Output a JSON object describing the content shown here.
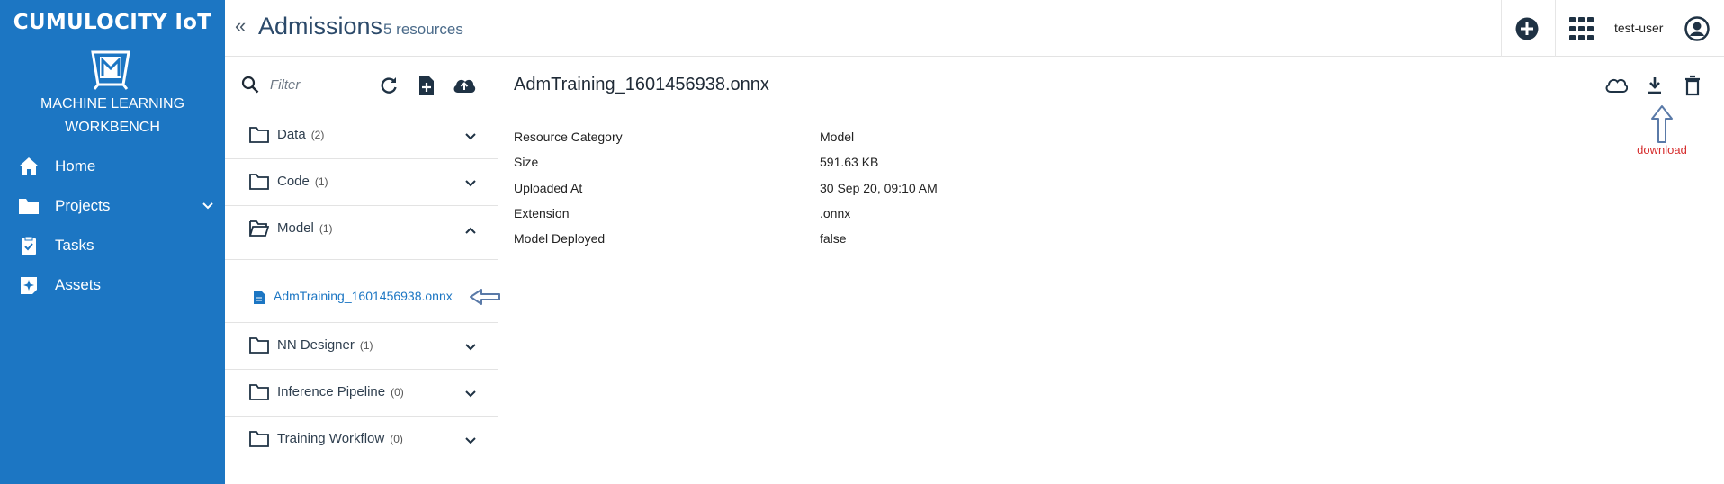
{
  "sidebar": {
    "brand": "CUMULOCITY IoT",
    "app_name_line1": "MACHINE LEARNING",
    "app_name_line2": "WORKBENCH",
    "items": [
      {
        "label": "Home",
        "icon": "home-icon"
      },
      {
        "label": "Projects",
        "icon": "folder-icon"
      },
      {
        "label": "Tasks",
        "icon": "clipboard-check-icon"
      },
      {
        "label": "Assets",
        "icon": "asset-icon"
      }
    ]
  },
  "header": {
    "collapse": "«",
    "title": "Admissions",
    "subtitle": "5 resources",
    "user": "test-user"
  },
  "list": {
    "filter_placeholder": "Filter",
    "folders": [
      {
        "name": "Data",
        "count": "(2)",
        "expanded": false
      },
      {
        "name": "Code",
        "count": "(1)",
        "expanded": false
      },
      {
        "name": "Model",
        "count": "(1)",
        "expanded": true
      },
      {
        "name": "NN Designer",
        "count": "(1)",
        "expanded": false
      },
      {
        "name": "Inference Pipeline",
        "count": "(0)",
        "expanded": false
      },
      {
        "name": "Training Workflow",
        "count": "(0)",
        "expanded": false
      }
    ],
    "selected_file": "AdmTraining_1601456938.onnx"
  },
  "detail": {
    "title": "AdmTraining_1601456938.onnx",
    "annotation": "download",
    "properties": [
      {
        "label": "Resource Category",
        "value": "Model"
      },
      {
        "label": "Size",
        "value": "591.63 KB"
      },
      {
        "label": "Uploaded At",
        "value": "30 Sep 20, 09:10 AM"
      },
      {
        "label": "Extension",
        "value": ".onnx"
      },
      {
        "label": "Model Deployed",
        "value": "false"
      }
    ]
  },
  "colors": {
    "sidebar": "#1c76c3",
    "icon_dark": "#1f3244",
    "link": "#1c76c3",
    "annotation": "#d62c2c"
  }
}
